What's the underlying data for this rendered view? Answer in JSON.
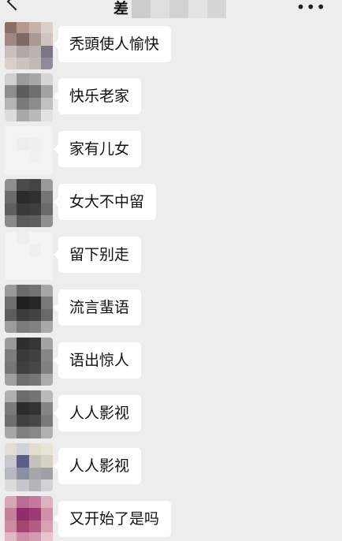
{
  "navbar": {
    "title_visible_char": "差",
    "more_label": "•••"
  },
  "messages": [
    {
      "text": "秃頭使人愉快"
    },
    {
      "text": "快乐老家"
    },
    {
      "text": "家有儿女"
    },
    {
      "text": "女大不中留"
    },
    {
      "text": "留下别走"
    },
    {
      "text": "流言蜚语"
    },
    {
      "text": "语出惊人"
    },
    {
      "text": "人人影视"
    },
    {
      "text": "人人影视"
    },
    {
      "text": "又开始了是吗"
    }
  ],
  "colors": {
    "background": "#ededed",
    "bubble": "#ffffff",
    "text": "#111111"
  }
}
